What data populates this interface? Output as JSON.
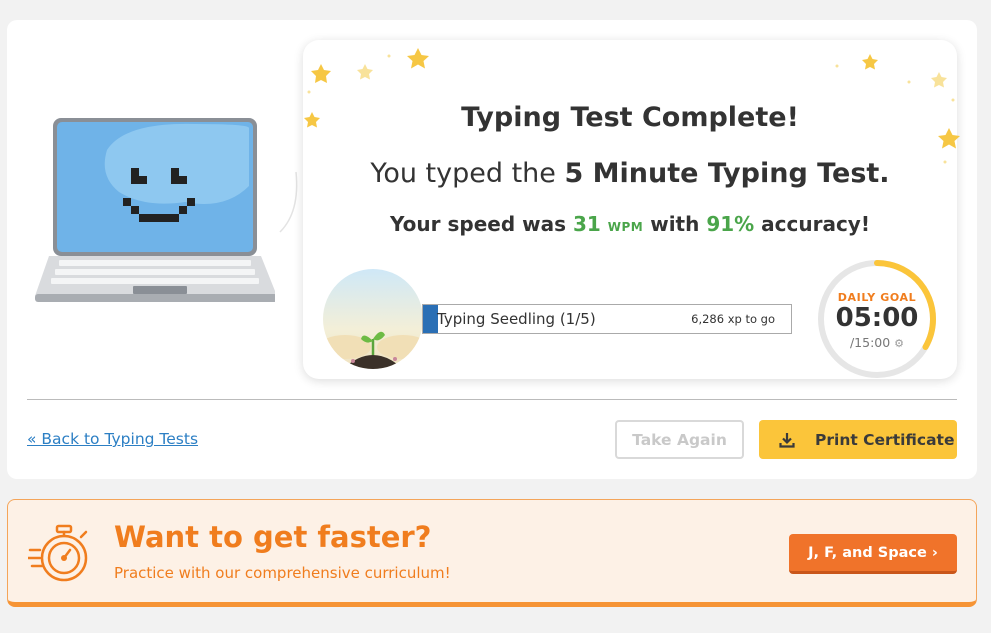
{
  "result": {
    "title": "Typing Test Complete!",
    "subtitle_prefix": "You typed the ",
    "test_name": "5 Minute Typing Test.",
    "speed_prefix": "Your speed was ",
    "wpm": "31",
    "wpm_unit": "WPM",
    "speed_middle": " with ",
    "accuracy": "91%",
    "speed_suffix": " accuracy!"
  },
  "level": {
    "name": "Typing Seedling (1/5)",
    "xp_to_go": "6,286 xp to go",
    "progress_fraction": 0.04
  },
  "daily_goal": {
    "label": "DAILY GOAL",
    "time": "05:00",
    "total": "/15:00",
    "progress_fraction": 0.333
  },
  "actions": {
    "back_link": "« Back to Typing Tests",
    "take_again": "Take Again",
    "print_certificate": "Print Certificate"
  },
  "promo": {
    "title": "Want to get faster?",
    "subtitle": "Practice with our comprehensive curriculum!",
    "button": "J, F, and Space ›"
  },
  "colors": {
    "accent_orange": "#f07d1e",
    "accent_yellow": "#fbc53a",
    "stat_green": "#4aa54a",
    "link_blue": "#2c7fc4",
    "progress_blue": "#2a6fb5"
  }
}
